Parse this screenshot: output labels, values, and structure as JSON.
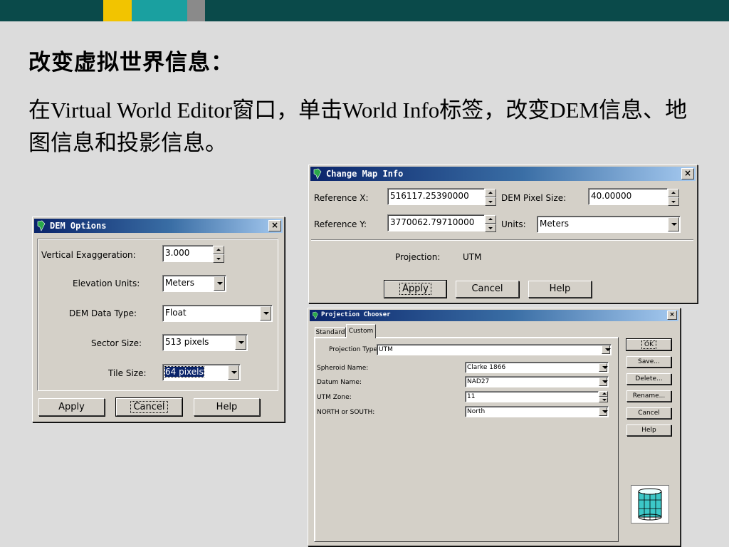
{
  "slide": {
    "title": "改变虚拟世界信息：",
    "body": "在Virtual World Editor窗口，单击World Info标签，改变DEM信息、地图信息和投影信息。"
  },
  "dem_options": {
    "title": "DEM Options",
    "close": "×",
    "vertical_exaggeration_label": "Vertical Exaggeration:",
    "vertical_exaggeration_value": "3.000",
    "elevation_units_label": "Elevation Units:",
    "elevation_units_value": "Meters",
    "dem_data_type_label": "DEM Data Type:",
    "dem_data_type_value": "Float",
    "sector_size_label": "Sector Size:",
    "sector_size_value": "513 pixels",
    "tile_size_label": "Tile Size:",
    "tile_size_value": "64 pixels",
    "apply": "Apply",
    "cancel": "Cancel",
    "help": "Help"
  },
  "change_map_info": {
    "title": "Change Map Info",
    "close": "×",
    "reference_x_label": "Reference X:",
    "reference_x_value": "516117.25390000",
    "reference_y_label": "Reference Y:",
    "reference_y_value": "3770062.79710000",
    "dem_pixel_size_label": "DEM Pixel Size:",
    "dem_pixel_size_value": "40.00000",
    "units_label": "Units:",
    "units_value": "Meters",
    "projection_label": "Projection:",
    "projection_value": "UTM",
    "apply": "Apply",
    "cancel": "Cancel",
    "help": "Help"
  },
  "projection_chooser": {
    "title": "Projection Chooser",
    "close": "×",
    "tabs": [
      "Standard",
      "Custom"
    ],
    "projection_type_label": "Projection Type :",
    "projection_type_value": "UTM",
    "spheroid_label": "Spheroid Name:",
    "spheroid_value": "Clarke 1866",
    "datum_label": "Datum Name:",
    "datum_value": "NAD27",
    "utm_zone_label": "UTM Zone:",
    "utm_zone_value": "11",
    "north_south_label": "NORTH or SOUTH:",
    "north_south_value": "North",
    "buttons": {
      "ok": "OK",
      "save": "Save...",
      "delete": "Delete...",
      "rename": "Rename...",
      "cancel": "Cancel",
      "help": "Help"
    }
  }
}
